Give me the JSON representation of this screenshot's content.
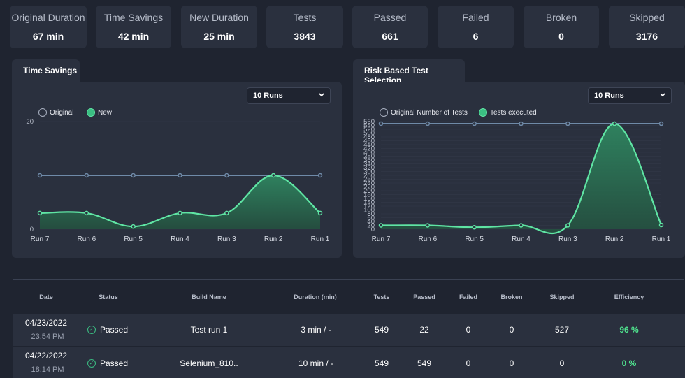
{
  "stats": [
    {
      "label": "Original Duration",
      "value": "67 min"
    },
    {
      "label": "Time Savings",
      "value": "42 min"
    },
    {
      "label": "New Duration",
      "value": "25 min"
    },
    {
      "label": "Tests",
      "value": "3843"
    },
    {
      "label": "Passed",
      "value": "661"
    },
    {
      "label": "Failed",
      "value": "6"
    },
    {
      "label": "Broken",
      "value": "0"
    },
    {
      "label": "Skipped",
      "value": "3176"
    }
  ],
  "time_savings": {
    "tab": "Time Savings",
    "select": "10 Runs",
    "legend": [
      "Original",
      "New"
    ],
    "y_ticks": [
      "20",
      "0"
    ],
    "categories": [
      "Run 7",
      "Run 6",
      "Run 5",
      "Run 4",
      "Run 3",
      "Run 2",
      "Run 1"
    ],
    "original": [
      10,
      10,
      10,
      10,
      10,
      10,
      10
    ],
    "new": [
      3,
      3,
      0.5,
      3,
      3,
      10,
      3
    ],
    "ylim": [
      0,
      20
    ]
  },
  "risk_based": {
    "tab": "Risk Based Test Selection",
    "select": "10 Runs",
    "legend": [
      "Original Number of Tests",
      "Tests executed"
    ],
    "y_ticks": [
      "560",
      "520",
      "480",
      "440",
      "400",
      "360",
      "320",
      "280",
      "240",
      "200",
      "160",
      "120",
      "80",
      "40",
      "0"
    ],
    "y_ticks_minor": [
      "540",
      "500",
      "460",
      "420",
      "380",
      "340",
      "300",
      "260",
      "220",
      "180",
      "140",
      "100",
      "60",
      "20"
    ],
    "categories": [
      "Run 7",
      "Run 6",
      "Run 5",
      "Run 4",
      "Run 3",
      "Run 2",
      "Run 1"
    ],
    "original": [
      549,
      549,
      549,
      549,
      549,
      549,
      549
    ],
    "executed": [
      20,
      20,
      10,
      20,
      20,
      549,
      22
    ],
    "ylim": [
      0,
      560
    ]
  },
  "table": {
    "headers": [
      "Date",
      "Status",
      "Build Name",
      "Duration (min)",
      "Tests",
      "Passed",
      "Failed",
      "Broken",
      "Skipped",
      "Efficiency"
    ],
    "rows": [
      {
        "date": "04/23/2022",
        "time": "23:54 PM",
        "status": "Passed",
        "build": "Test run 1",
        "duration": "3 min / -",
        "tests": "549",
        "passed": "22",
        "failed": "0",
        "broken": "0",
        "skipped": "527",
        "efficiency": "96 %"
      },
      {
        "date": "04/22/2022",
        "time": "18:14 PM",
        "status": "Passed",
        "build": "Selenium_810..",
        "duration": "10 min / -",
        "tests": "549",
        "passed": "549",
        "failed": "0",
        "broken": "0",
        "skipped": "0",
        "efficiency": "0 %"
      }
    ]
  },
  "colors": {
    "original_line": "#6f8aa8",
    "new_line": "#5fe5a4",
    "fill_top": "#2f8a62",
    "fill_bottom": "#24503f",
    "efficiency": "#4fe38e"
  }
}
